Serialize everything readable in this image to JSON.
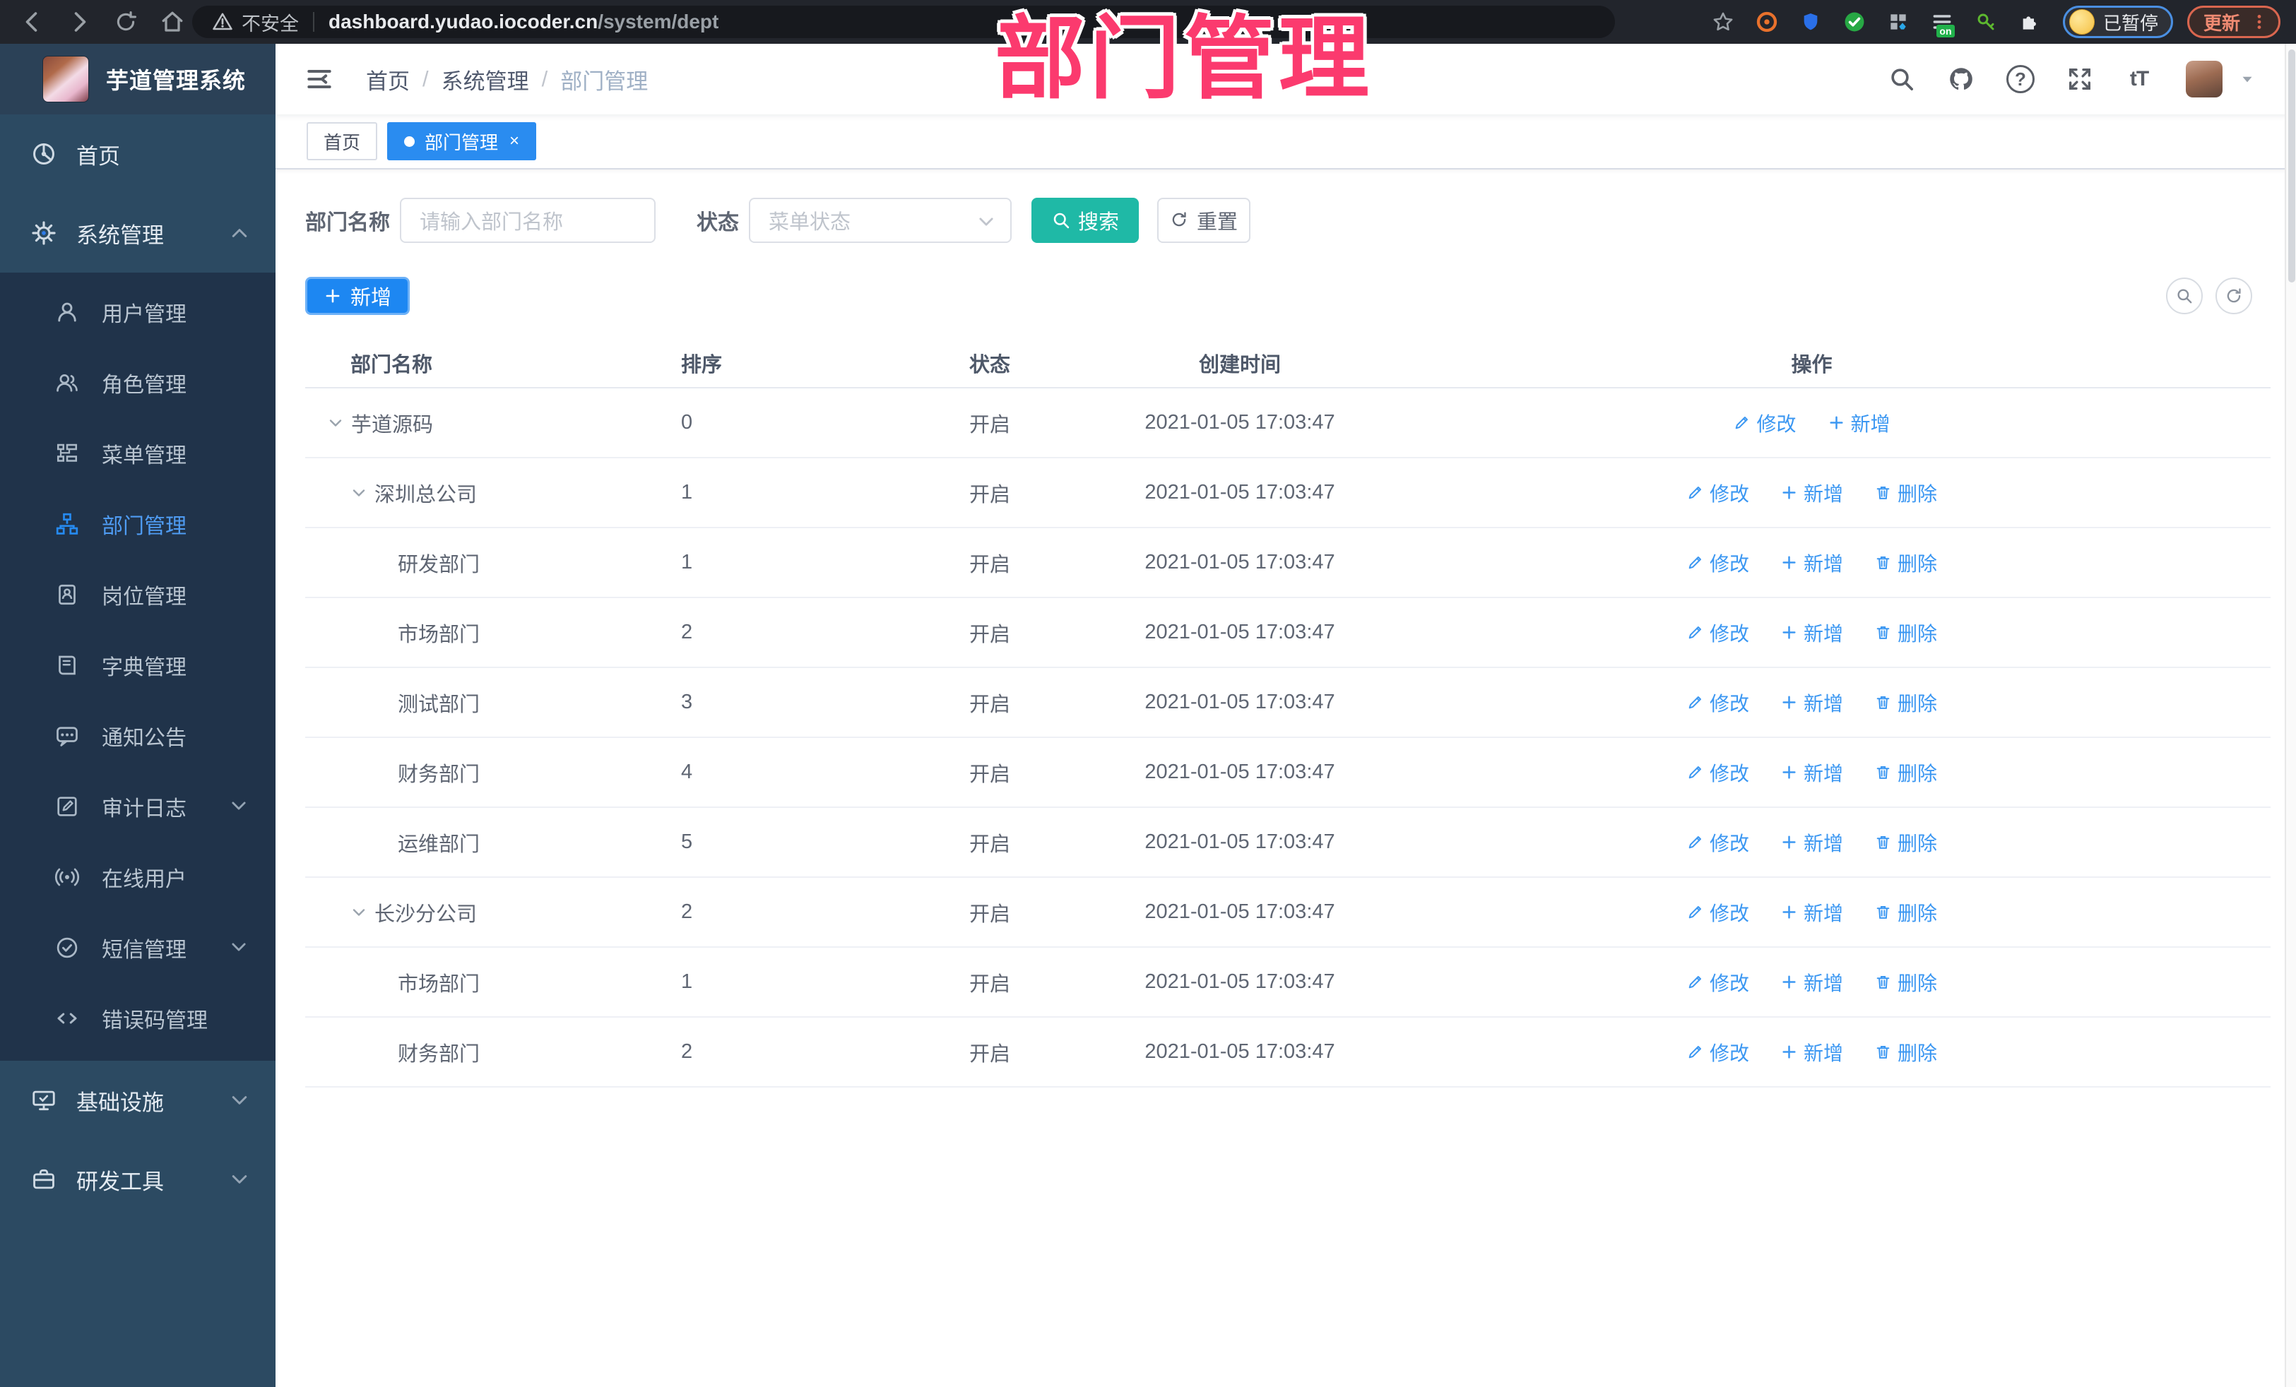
{
  "colors": {
    "accent_blue": "#2a8cf0",
    "teal": "#1fb9a6",
    "annotation_pink": "#fb3a6e",
    "sidebar_bg": "#2c4a62",
    "submenu_bg": "#20334a"
  },
  "browser": {
    "security_label": "不安全",
    "url_host": "dashboard.yudao.iocoder.cn",
    "url_path": "/system/dept",
    "profile_status": "已暂停",
    "update_label": "更新"
  },
  "annotation": {
    "title": "部门管理"
  },
  "sidebar": {
    "logo_text": "芋道管理系统",
    "top_items": [
      {
        "label": "首页"
      },
      {
        "label": "系统管理"
      }
    ],
    "sub_items": [
      {
        "label": "用户管理"
      },
      {
        "label": "角色管理"
      },
      {
        "label": "菜单管理"
      },
      {
        "label": "部门管理"
      },
      {
        "label": "岗位管理"
      },
      {
        "label": "字典管理"
      },
      {
        "label": "通知公告"
      },
      {
        "label": "审计日志"
      },
      {
        "label": "在线用户"
      },
      {
        "label": "短信管理"
      },
      {
        "label": "错误码管理"
      }
    ],
    "bottom_items": [
      {
        "label": "基础设施"
      },
      {
        "label": "研发工具"
      }
    ]
  },
  "header": {
    "breadcrumb": {
      "home": "首页",
      "parent": "系统管理",
      "current": "部门管理"
    },
    "font_size_icon": "tT",
    "help_glyph": "?"
  },
  "tabs": {
    "home": "首页",
    "active": "部门管理",
    "close_glyph": "×"
  },
  "filters": {
    "dept_label": "部门名称",
    "dept_placeholder": "请输入部门名称",
    "status_label": "状态",
    "status_placeholder": "菜单状态",
    "search_label": "搜索",
    "reset_label": "重置"
  },
  "toolbar": {
    "add_label": "新增"
  },
  "table": {
    "columns": {
      "name": "部门名称",
      "sort": "排序",
      "status": "状态",
      "created": "创建时间",
      "actions": "操作"
    },
    "rows": [
      {
        "name": "芋道源码",
        "sort": "0",
        "status": "开启",
        "created": "2021-01-05 17:03:47",
        "actions": {
          "edit": "修改",
          "add": "新增"
        }
      },
      {
        "name": "深圳总公司",
        "sort": "1",
        "status": "开启",
        "created": "2021-01-05 17:03:47",
        "actions": {
          "edit": "修改",
          "add": "新增",
          "del": "删除"
        }
      },
      {
        "name": "研发部门",
        "sort": "1",
        "status": "开启",
        "created": "2021-01-05 17:03:47",
        "actions": {
          "edit": "修改",
          "add": "新增",
          "del": "删除"
        }
      },
      {
        "name": "市场部门",
        "sort": "2",
        "status": "开启",
        "created": "2021-01-05 17:03:47",
        "actions": {
          "edit": "修改",
          "add": "新增",
          "del": "删除"
        }
      },
      {
        "name": "测试部门",
        "sort": "3",
        "status": "开启",
        "created": "2021-01-05 17:03:47",
        "actions": {
          "edit": "修改",
          "add": "新增",
          "del": "删除"
        }
      },
      {
        "name": "财务部门",
        "sort": "4",
        "status": "开启",
        "created": "2021-01-05 17:03:47",
        "actions": {
          "edit": "修改",
          "add": "新增",
          "del": "删除"
        }
      },
      {
        "name": "运维部门",
        "sort": "5",
        "status": "开启",
        "created": "2021-01-05 17:03:47",
        "actions": {
          "edit": "修改",
          "add": "新增",
          "del": "删除"
        }
      },
      {
        "name": "长沙分公司",
        "sort": "2",
        "status": "开启",
        "created": "2021-01-05 17:03:47",
        "actions": {
          "edit": "修改",
          "add": "新增",
          "del": "删除"
        }
      },
      {
        "name": "市场部门",
        "sort": "1",
        "status": "开启",
        "created": "2021-01-05 17:03:47",
        "actions": {
          "edit": "修改",
          "add": "新增",
          "del": "删除"
        }
      },
      {
        "name": "财务部门",
        "sort": "2",
        "status": "开启",
        "created": "2021-01-05 17:03:47",
        "actions": {
          "edit": "修改",
          "add": "新增",
          "del": "删除"
        }
      }
    ]
  }
}
